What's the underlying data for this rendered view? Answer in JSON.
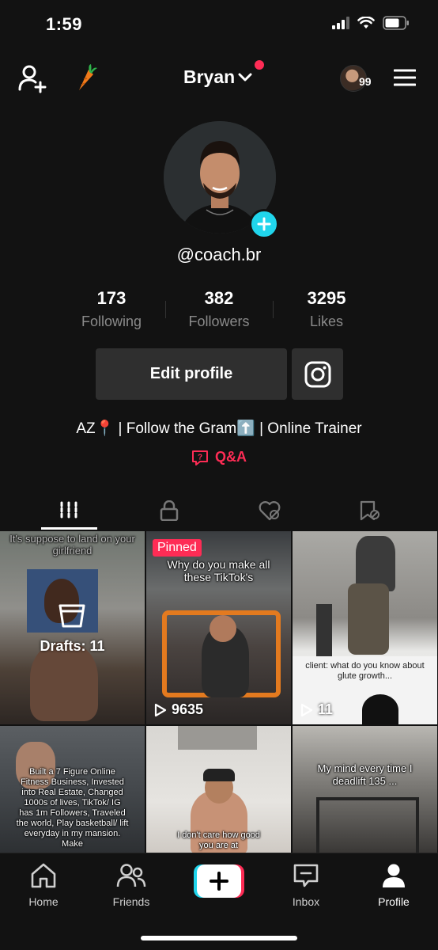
{
  "status_bar": {
    "time": "1:59"
  },
  "header": {
    "username": "Bryan",
    "notification_count": "99"
  },
  "profile": {
    "handle": "@coach.br",
    "stats": [
      {
        "value": "173",
        "label": "Following"
      },
      {
        "value": "382",
        "label": "Followers"
      },
      {
        "value": "3295",
        "label": "Likes"
      }
    ],
    "edit_button_label": "Edit profile",
    "bio": "AZ📍 | Follow the Gram⬆️ | Online Trainer",
    "qa_label": "Q&A"
  },
  "tabs": [
    {
      "name": "videos",
      "icon": "grid-icon",
      "active": true
    },
    {
      "name": "private",
      "icon": "lock-icon",
      "active": false
    },
    {
      "name": "liked",
      "icon": "liked-hidden-icon",
      "active": false
    },
    {
      "name": "favorites",
      "icon": "favorites-hidden-icon",
      "active": false
    }
  ],
  "videos": [
    {
      "caption": "It's suppose to land on your girlfriend",
      "overlay": "Drafts: 11",
      "views": ""
    },
    {
      "caption": "Why do you make all these TikTok's",
      "badge": "Pinned",
      "views": "9635"
    },
    {
      "caption": "client: what do you know about glute growth...",
      "views": "11"
    },
    {
      "caption": "Built a 7 Figure Online Fitness Business, Invested into Real Estate, Changed 1000s of lives, TikTok/ IG has 1m Followers, Traveled the world, Play basketball/ lift everyday in my mansion. Make",
      "views": ""
    },
    {
      "caption": "I don't care how good you are at",
      "views": ""
    },
    {
      "caption": "My mind every time I deadlift 135 ...",
      "views": ""
    }
  ],
  "bottom_nav": {
    "items": [
      {
        "label": "Home",
        "icon": "home-icon"
      },
      {
        "label": "Friends",
        "icon": "friends-icon"
      },
      {
        "label": "Inbox",
        "icon": "inbox-icon"
      },
      {
        "label": "Profile",
        "icon": "profile-icon"
      }
    ]
  },
  "colors": {
    "accent": "#fe2c55",
    "cyan": "#20d5ec",
    "background": "#121212"
  }
}
